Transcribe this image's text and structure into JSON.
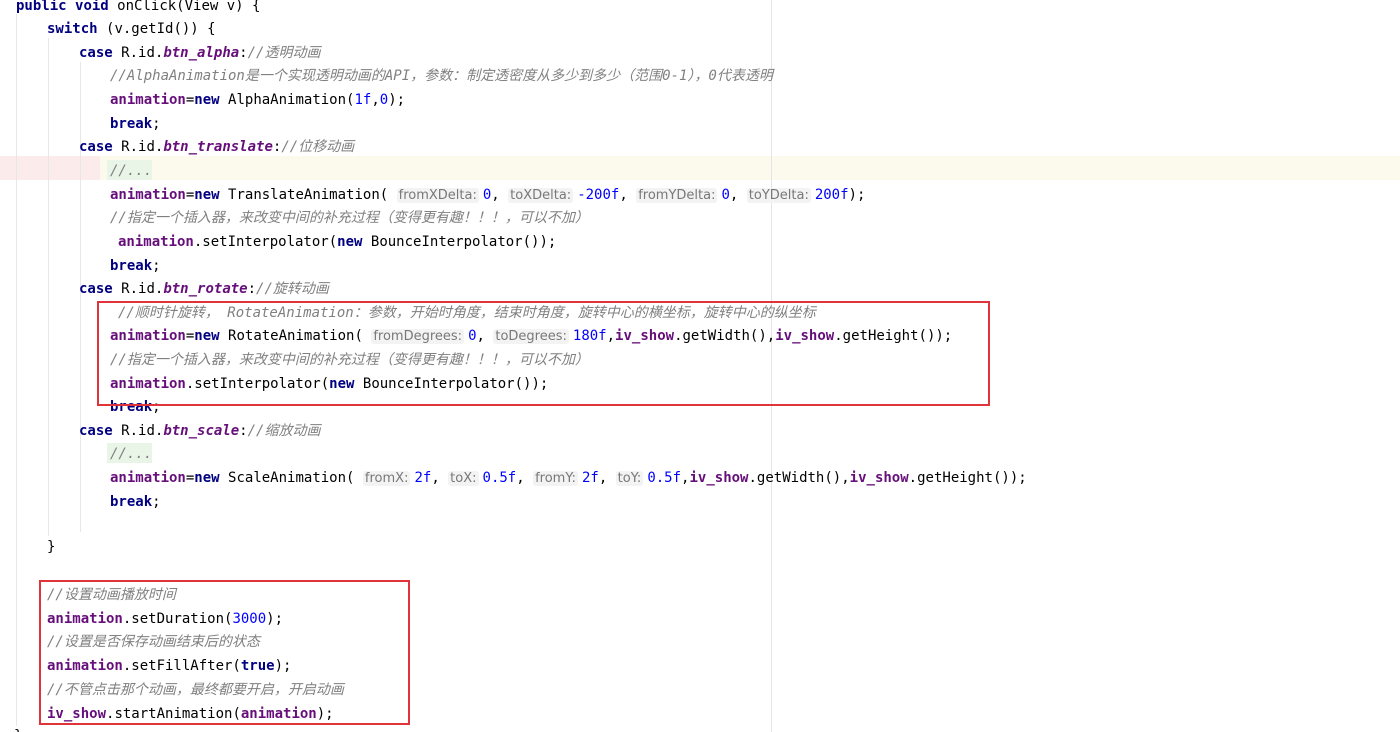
{
  "code": {
    "method_signature": {
      "kw_public": "public",
      "kw_void": "void",
      "name": "onClick(View v) {"
    },
    "switch_line": {
      "kw": "switch",
      "rest": "(v.getId()) {"
    },
    "case_alpha": {
      "kw": "case",
      "prefix": "R.id.",
      "id": "btn_alpha",
      "colon": ":",
      "comment": "//透明动画"
    },
    "comment_alpha_api": "//AlphaAnimation是一个实现透明动画的API，参数：制定透密度从多少到多少（范围0-1），0代表透明",
    "alpha_new": {
      "var": "animation",
      "eq": "=",
      "kw_new": "new",
      "cls": "AlphaAnimation(",
      "arg1": "1f",
      "sep": ",",
      "arg2": "0",
      "end": ");"
    },
    "break_kw": "break",
    "break_end": ";",
    "case_translate": {
      "kw": "case",
      "prefix": "R.id.",
      "id": "btn_translate",
      "colon": ":",
      "comment": "//位移动画"
    },
    "folded_comment": "//...",
    "translate_new": {
      "var": "animation",
      "eq": "=",
      "kw_new": "new",
      "cls": "TranslateAnimation(",
      "hint1": "fromXDelta:",
      "val1": "0",
      "hint2": "toXDelta:",
      "val2": "-200f",
      "hint3": "fromYDelta:",
      "val3": "0",
      "hint4": "toYDelta:",
      "val4": "200f",
      "end": ");"
    },
    "comment_interpolator": "//指定一个插入器，来改变中间的补充过程（变得更有趣！！！，可以不加）",
    "set_interpolator": {
      "var": "animation",
      "method": ".setInterpolator(",
      "kw_new": "new",
      "cls": "BounceInterpolator());"
    },
    "case_rotate": {
      "kw": "case",
      "prefix": "R.id.",
      "id": "btn_rotate",
      "colon": ":",
      "comment": "//旋转动画"
    },
    "comment_rotate": "//顺时针旋转， RotateAnimation：参数，开始时角度，结束时角度，旋转中心的横坐标，旋转中心的纵坐标",
    "rotate_new": {
      "var": "animation",
      "eq": "=",
      "kw_new": "new",
      "cls": "RotateAnimation(",
      "hint1": "fromDegrees:",
      "val1": "0",
      "hint2": "toDegrees:",
      "val2": "180f",
      "field1": "iv_show",
      "call1": ".getWidth(),",
      "field2": "iv_show",
      "call2": ".getHeight());"
    },
    "case_scale": {
      "kw": "case",
      "prefix": "R.id.",
      "id": "btn_scale",
      "colon": ":",
      "comment": "//缩放动画"
    },
    "scale_new": {
      "var": "animation",
      "eq": "=",
      "kw_new": "new",
      "cls": "ScaleAnimation(",
      "hint1": "fromX:",
      "val1": "2f",
      "hint2": "toX:",
      "val2": "0.5f",
      "hint3": "fromY:",
      "val3": "2f",
      "hint4": "toY:",
      "val4": "0.5f",
      "field1": "iv_show",
      "call1": ".getWidth(),",
      "field2": "iv_show",
      "call2": ".getHeight());"
    },
    "close_brace": "}",
    "comment_duration": "//设置动画播放时间",
    "set_duration": {
      "var": "animation",
      "method": ".setDuration(",
      "val": "3000",
      "end": ");"
    },
    "comment_fill": "//设置是否保存动画结束后的状态",
    "set_fill": {
      "var": "animation",
      "method": ".setFillAfter(",
      "val": "true",
      "end": ");"
    },
    "comment_start": "//不管点击那个动画，最终都要开启，开启动画",
    "start_anim": {
      "field": "iv_show",
      "method": ".startAnimation(",
      "var": "animation",
      "end": ");"
    },
    "trailing_brace": "}"
  },
  "colors": {
    "keyword": "#000080",
    "field": "#660e7a",
    "number": "#0000ff",
    "comment": "#808080",
    "highlight_box": "#e0343a",
    "current_line": "#fcfaed"
  }
}
